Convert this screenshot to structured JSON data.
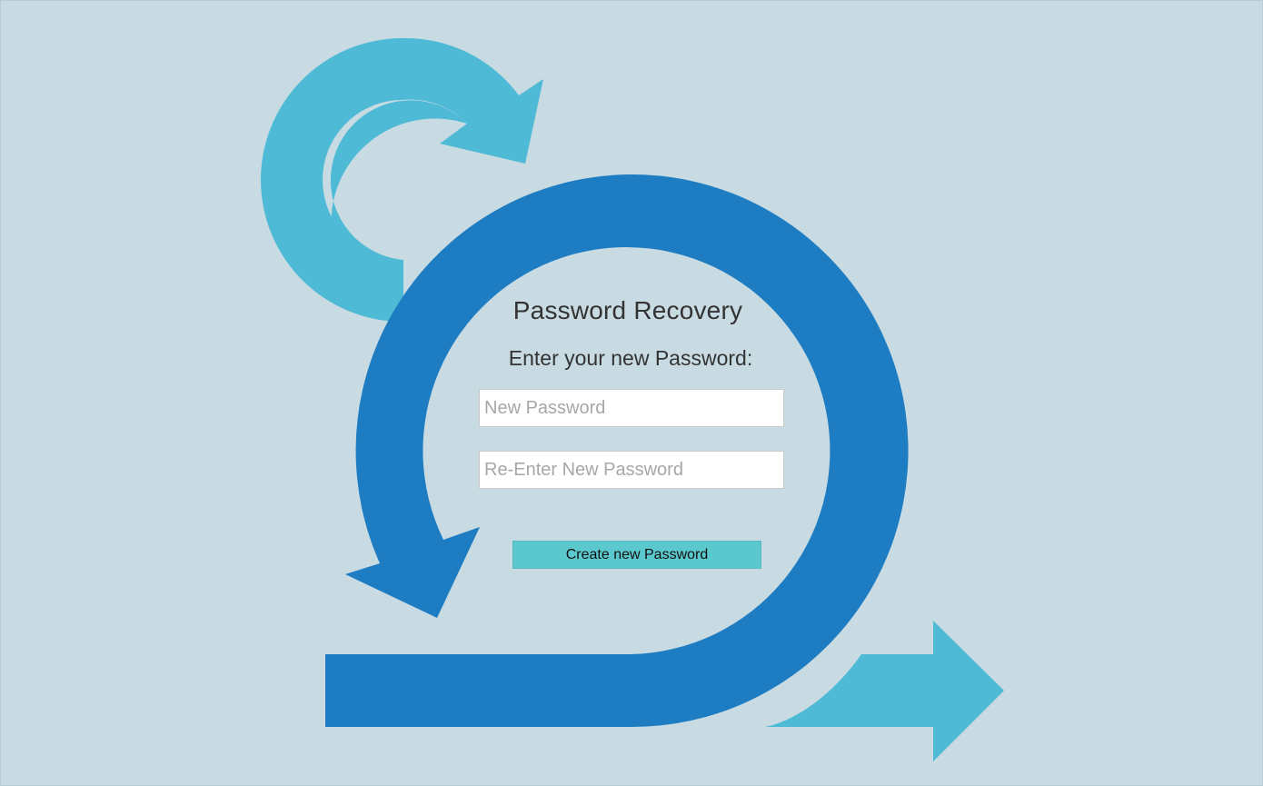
{
  "page": {
    "title": "Password Recovery",
    "instruction": "Enter your new Password:"
  },
  "form": {
    "new_password": {
      "value": "",
      "placeholder": "New Password"
    },
    "reenter_password": {
      "value": "",
      "placeholder": "Re-Enter New Password"
    },
    "submit_label": "Create new Password"
  },
  "colors": {
    "background": "#c8dbe3",
    "cycle_arrow_dark": "#1e7dc2",
    "cycle_arrow_light": "#4fbad6",
    "button": "#5bc8cd"
  },
  "icons": {
    "background_graphic": "scrum-cycle-arrows"
  }
}
